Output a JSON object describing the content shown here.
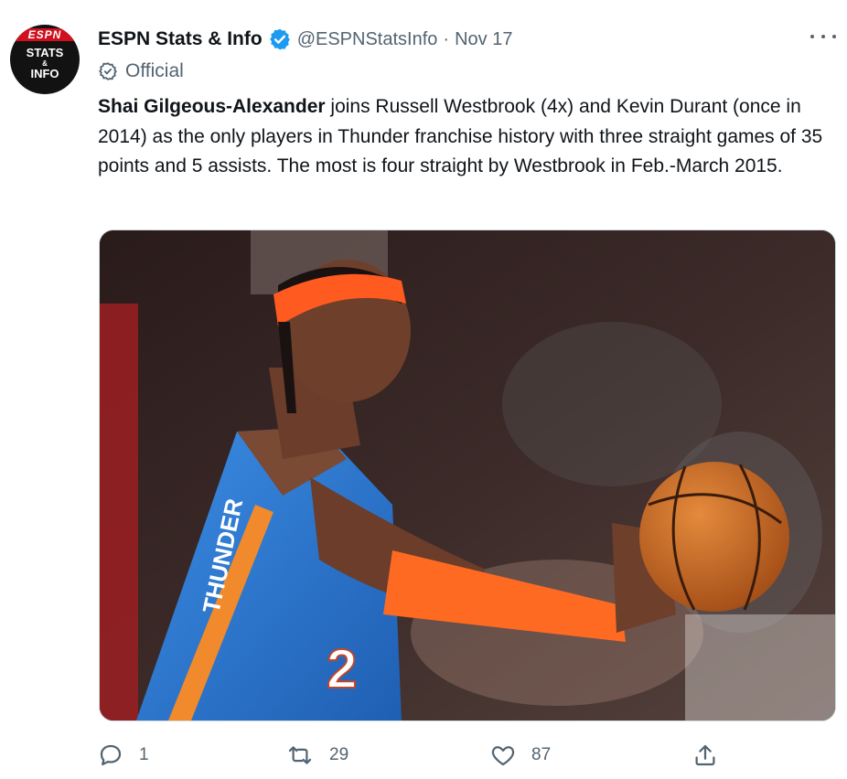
{
  "account": {
    "name": "ESPN Stats & Info",
    "handle": "@ESPNStatsInfo",
    "separator": "·",
    "date": "Nov 17",
    "label": "Official",
    "avatar": {
      "brand": "ESPN",
      "line1": "STATS",
      "line2": "&",
      "line3": "INFO"
    }
  },
  "tweet": {
    "bold_lead": "Shai Gilgeous-Alexander",
    "text": " joins Russell Westbrook (4x) and Kevin Durant (once in 2014) as the only players in Thunder franchise history with three straight games of 35 points and 5 assists.  The most is four straight by Westbrook in Feb.-March 2015."
  },
  "media": {
    "jersey_text": "THUNDER",
    "jersey_number": "2"
  },
  "actions": {
    "reply_count": "1",
    "retweet_count": "29",
    "like_count": "87"
  },
  "colors": {
    "verified": "#1d9bf0",
    "muted": "#536471",
    "headband": "#ff5a1f",
    "jersey": "#2f7bd6"
  },
  "icons": [
    "more-icon",
    "verified-icon",
    "official-icon",
    "reply-icon",
    "retweet-icon",
    "like-icon",
    "share-icon"
  ]
}
